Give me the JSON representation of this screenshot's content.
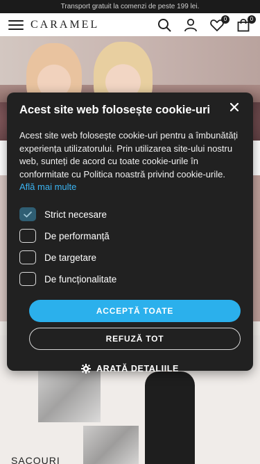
{
  "promo": {
    "text": "Transport gratuit la comenzi de peste 199 lei."
  },
  "header": {
    "logo": "CARAMEL",
    "wishlist_count": "0",
    "cart_count": "0"
  },
  "page": {
    "section_label": "SACOURI"
  },
  "cookie": {
    "title": "Acest site web folosește cookie-uri",
    "body": "Acest site web folosește cookie-uri pentru a îmbunătăți experiența utilizatorului. Prin utilizarea site-ului nostru web, sunteți de acord cu toate cookie-urile în conformitate cu Politica noastră privind cookie-urile.",
    "link": "Află mai multe",
    "options": [
      {
        "label": "Strict necesare",
        "checked": true
      },
      {
        "label": "De performanță",
        "checked": false
      },
      {
        "label": "De targetare",
        "checked": false
      },
      {
        "label": "De funcționalitate",
        "checked": false
      }
    ],
    "accept_label": "ACCEPTĂ TOATE",
    "refuse_label": "REFUZĂ TOT",
    "details_label": "ARATĂ DETALIILE"
  },
  "colors": {
    "modal_bg": "#212121",
    "accent": "#2bb0ec",
    "link": "#3bb4f2",
    "checked_box": "#2f5e73"
  },
  "icons": [
    "menu-icon",
    "search-icon",
    "user-icon",
    "heart-icon",
    "shopping-bag-icon",
    "close-icon",
    "checkmark-icon",
    "gear-icon"
  ]
}
